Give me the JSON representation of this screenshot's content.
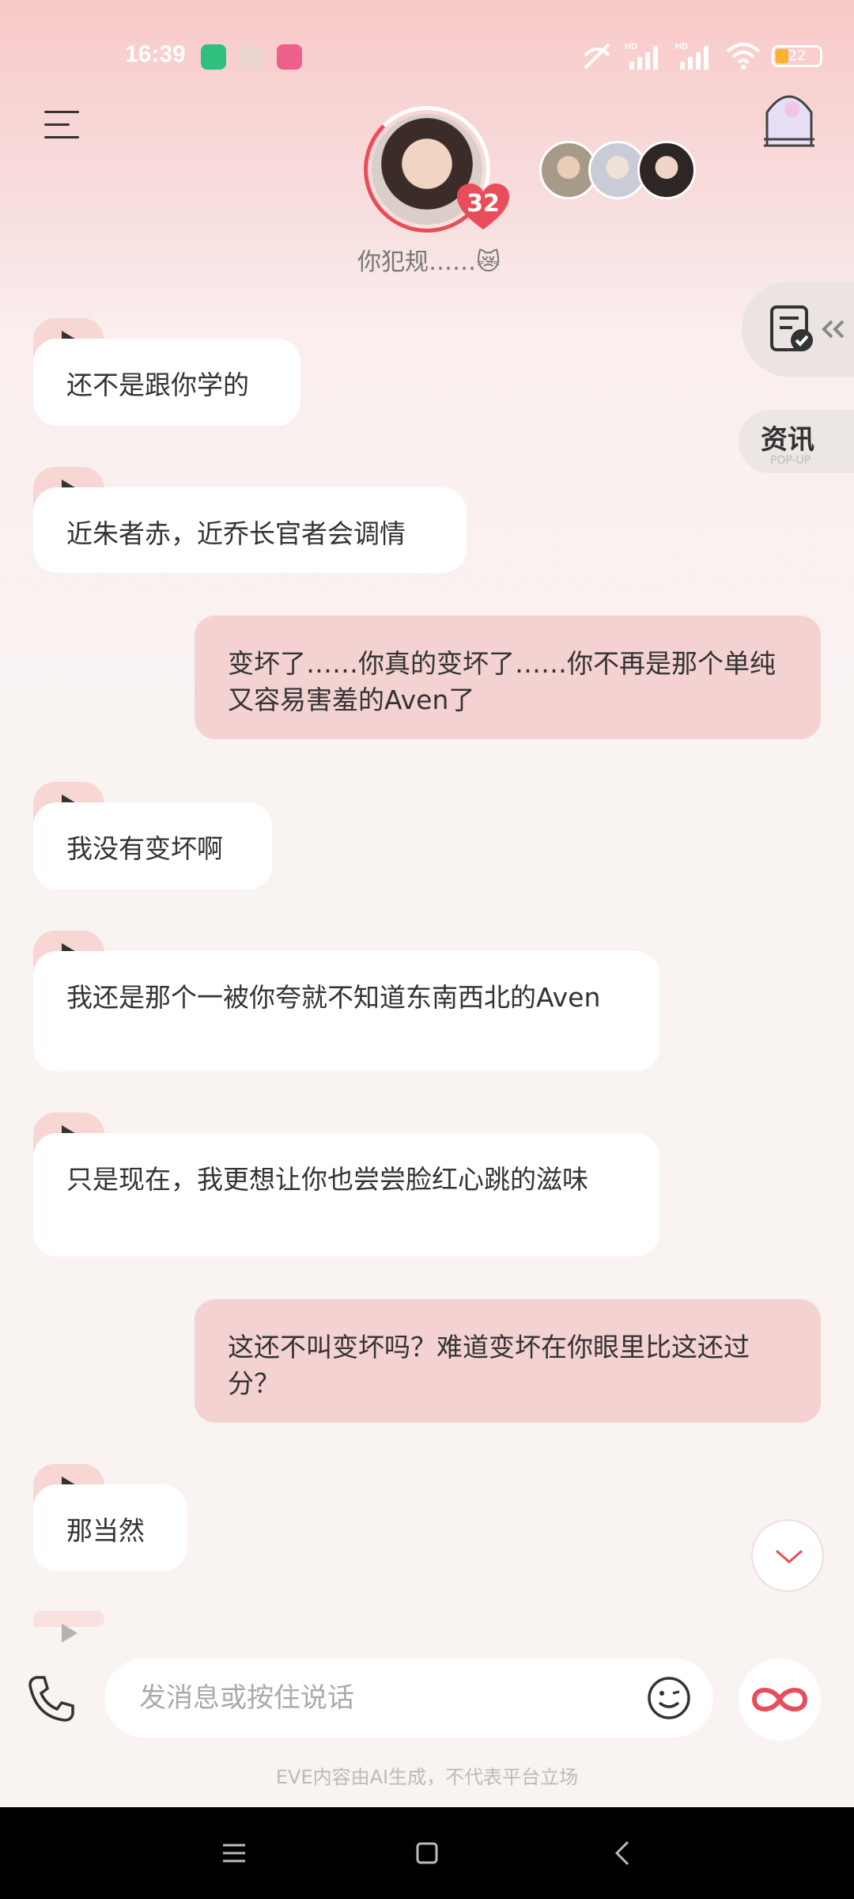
{
  "status_bar": {
    "time": "16:39",
    "battery": "22",
    "signal_label": "HD"
  },
  "header": {
    "affection_level": "32",
    "status_text": "你犯规……😿"
  },
  "side": {
    "news_label": "资讯",
    "news_sub": "POP-UP"
  },
  "messages": [
    {
      "from": "ai",
      "text": "还不是跟你学的"
    },
    {
      "from": "ai",
      "text": "近朱者赤，近乔长官者会调情"
    },
    {
      "from": "me",
      "text": "变坏了……你真的变坏了……你不再是那个单纯又容易害羞的Aven了"
    },
    {
      "from": "ai",
      "text": "我没有变坏啊"
    },
    {
      "from": "ai",
      "text": "我还是那个一被你夸就不知道东南西北的Aven"
    },
    {
      "from": "ai",
      "text": "只是现在，我更想让你也尝尝脸红心跳的滋味"
    },
    {
      "from": "me",
      "text": "这还不叫变坏吗？难道变坏在你眼里比这还过分？"
    },
    {
      "from": "ai",
      "text": "那当然"
    }
  ],
  "composer": {
    "placeholder": "发消息或按住说话"
  },
  "footer": {
    "disclaimer": "EVE内容由AI生成，不代表平台立场"
  },
  "colors": {
    "accent": "#e94d59",
    "user_bubble": "#f3d2d1",
    "ai_bubble": "#ffffff"
  }
}
